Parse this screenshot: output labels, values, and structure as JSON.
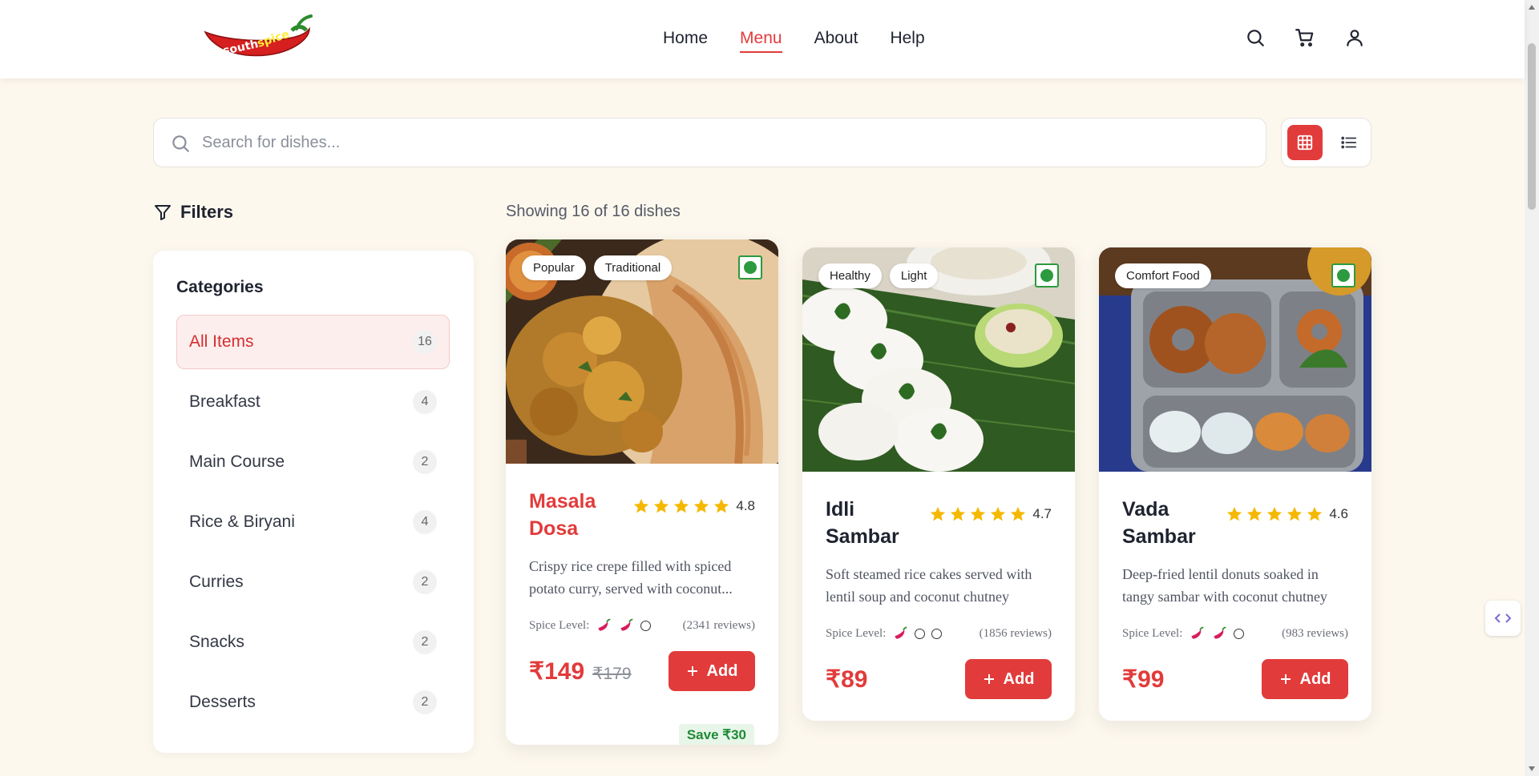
{
  "brand": {
    "logo_text": "Southspice"
  },
  "nav": {
    "items": [
      {
        "label": "Home"
      },
      {
        "label": "Menu"
      },
      {
        "label": "About"
      },
      {
        "label": "Help"
      }
    ],
    "active": "Menu"
  },
  "header_icons": [
    "search-icon",
    "cart-icon",
    "user-icon"
  ],
  "search": {
    "placeholder": "Search for dishes...",
    "value": ""
  },
  "view_toggle": {
    "selected": "grid",
    "options": [
      "grid-icon",
      "list-icon"
    ]
  },
  "filters": {
    "title": "Filters",
    "categories_heading": "Categories",
    "categories": [
      {
        "name": "All Items",
        "count": "16",
        "active": true
      },
      {
        "name": "Breakfast",
        "count": "4"
      },
      {
        "name": "Main Course",
        "count": "2"
      },
      {
        "name": "Rice & Biryani",
        "count": "4"
      },
      {
        "name": "Curries",
        "count": "2"
      },
      {
        "name": "Snacks",
        "count": "2"
      },
      {
        "name": "Desserts",
        "count": "2"
      }
    ]
  },
  "results": {
    "showing": "Showing 16 of 16 dishes",
    "dishes": [
      {
        "name": "Masala Dosa",
        "tags": [
          "Popular",
          "Traditional"
        ],
        "rating": "4.8",
        "description": "Crispy rice crepe filled with spiced potato curry, served with coconut...",
        "spice_label": "Spice Level:",
        "spice_level": 2,
        "reviews": "(2341 reviews)",
        "price": "₹149",
        "old_price": "₹179",
        "save": "Save ₹30",
        "add_label": "Add",
        "veg": true
      },
      {
        "name": "Idli Sambar",
        "tags": [
          "Healthy",
          "Light"
        ],
        "rating": "4.7",
        "description": "Soft steamed rice cakes served with lentil soup and coconut chutney",
        "spice_label": "Spice Level:",
        "spice_level": 1,
        "reviews": "(1856 reviews)",
        "price": "₹89",
        "add_label": "Add",
        "veg": true
      },
      {
        "name": "Vada Sambar",
        "tags": [
          "Comfort Food"
        ],
        "rating": "4.6",
        "description": "Deep-fried lentil donuts soaked in tangy sambar with coconut chutney",
        "spice_label": "Spice Level:",
        "spice_level": 2,
        "reviews": "(983 reviews)",
        "price": "₹99",
        "add_label": "Add",
        "veg": true
      }
    ]
  },
  "colors": {
    "accent": "#e23b3b",
    "background": "#fdf8ee",
    "veg": "#2c9a3f",
    "star": "#f5b800"
  }
}
